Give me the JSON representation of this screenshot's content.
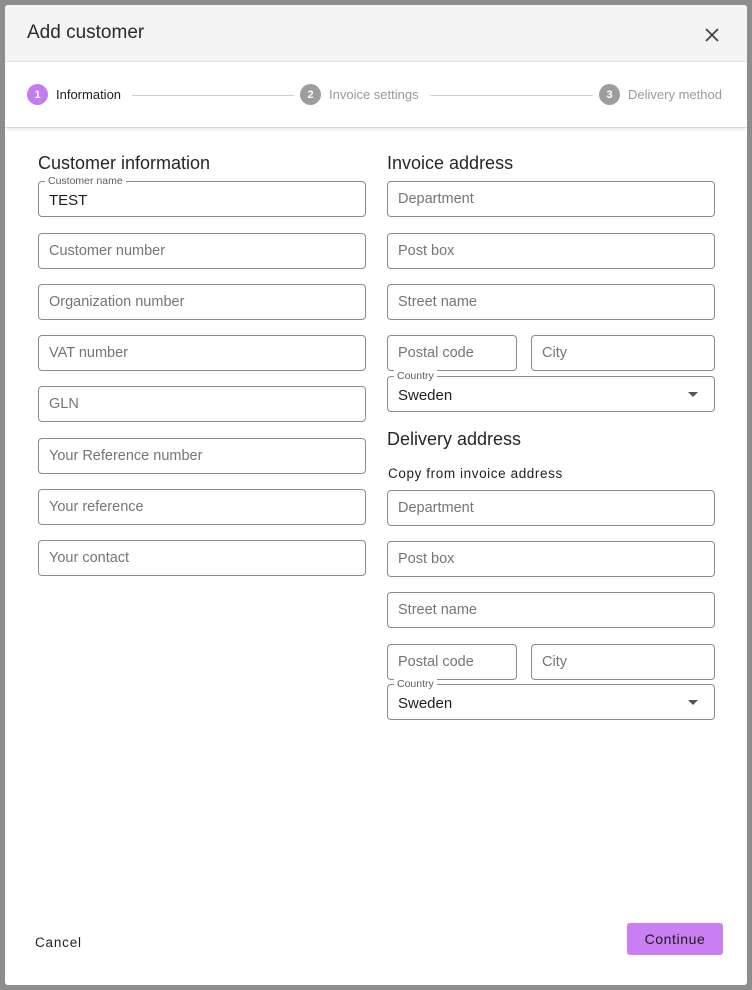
{
  "dialog": {
    "title": "Add customer"
  },
  "stepper": {
    "steps": [
      {
        "number": "1",
        "label": "Information"
      },
      {
        "number": "2",
        "label": "Invoice settings"
      },
      {
        "number": "3",
        "label": "Delivery method"
      }
    ]
  },
  "customer_info": {
    "heading": "Customer information",
    "customer_name": {
      "label": "Customer name",
      "value": "TEST"
    },
    "customer_number": "Customer number",
    "organization_number": "Organization number",
    "vat_number": "VAT number",
    "gln": "GLN",
    "your_reference_number": "Your Reference number",
    "your_reference": "Your reference",
    "your_contact": "Your contact"
  },
  "invoice_address": {
    "heading": "Invoice address",
    "department": "Department",
    "post_box": "Post box",
    "street_name": "Street name",
    "postal_code": "Postal code",
    "city": "City",
    "country": {
      "label": "Country",
      "value": "Sweden"
    }
  },
  "delivery_address": {
    "heading": "Delivery address",
    "copy_link": "Copy from invoice address",
    "department": "Department",
    "post_box": "Post box",
    "street_name": "Street name",
    "postal_code": "Postal code",
    "city": "City",
    "country": {
      "label": "Country",
      "value": "Sweden"
    }
  },
  "footer": {
    "cancel": "Cancel",
    "continue": "Continue"
  },
  "colors": {
    "accent": "#c97ff2",
    "step_active": "#c27ef0",
    "step_inactive": "#9d9d9d"
  }
}
